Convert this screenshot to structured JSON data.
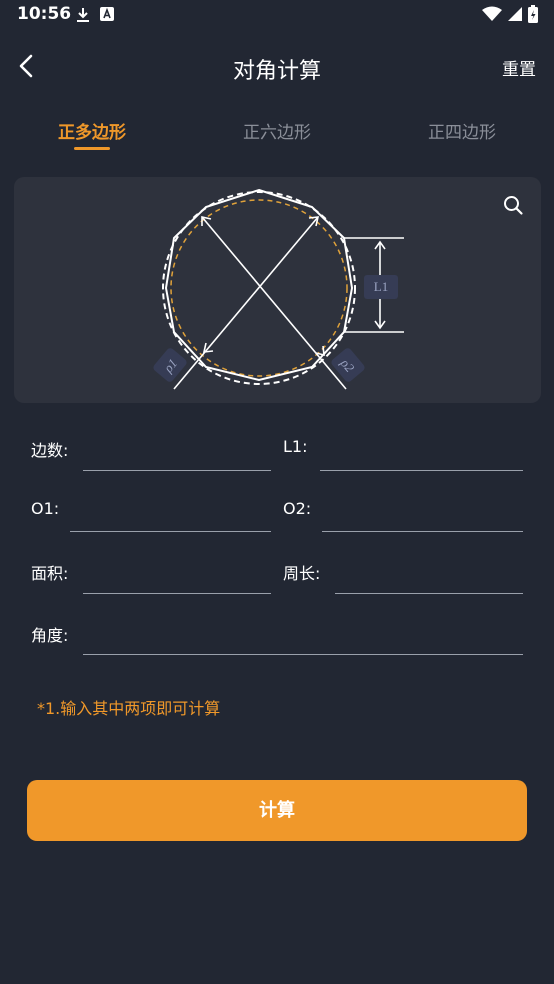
{
  "status_bar": {
    "time": "10:56",
    "left_icons": [
      "download-icon",
      "a-badge-icon"
    ],
    "right_icons": [
      "wifi-icon",
      "signal-icon",
      "battery-icon"
    ]
  },
  "header": {
    "title": "对角计算",
    "reset_label": "重置",
    "back_icon": "chevron-left-icon"
  },
  "tabs": [
    {
      "label": "正多边形",
      "active": true
    },
    {
      "label": "正六边形",
      "active": false
    },
    {
      "label": "正四边形",
      "active": false
    }
  ],
  "diagram": {
    "dimension_label": "L1",
    "diag1_label": "ρ1",
    "diag2_label": "ρ2",
    "zoom_icon": "search-icon"
  },
  "form": {
    "sides_label": "边数:",
    "l1_label": "L1:",
    "o1_label": "O1:",
    "o2_label": "O2:",
    "area_label": "面积:",
    "perimeter_label": "周长:",
    "angle_label": "角度:",
    "sides_value": "",
    "l1_value": "",
    "o1_value": "",
    "o2_value": "",
    "area_value": "",
    "perimeter_value": "",
    "angle_value": ""
  },
  "hint": "*1.输入其中两项即可计算",
  "calculate_label": "计算",
  "colors": {
    "background": "#222733",
    "card": "#2e323d",
    "accent": "#f0982a",
    "inactive_tab": "#8b8f99"
  }
}
